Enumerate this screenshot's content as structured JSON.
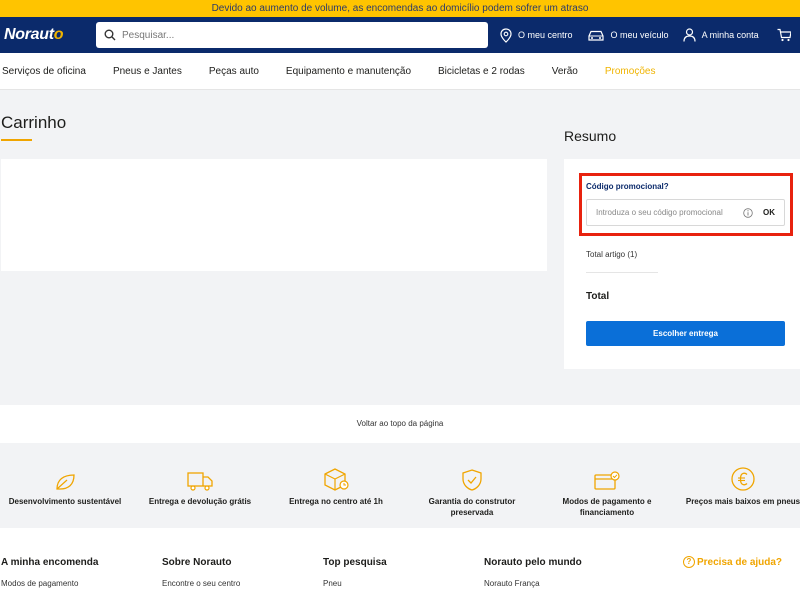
{
  "banner": {
    "text": "Devido ao aumento de volume, as encomendas ao domicílio podem sofrer um atraso"
  },
  "header": {
    "logo_main": "Norauto",
    "search_placeholder": "Pesquisar...",
    "links": {
      "centre": "O meu centro",
      "vehicle": "O meu veículo",
      "account": "A minha conta"
    }
  },
  "nav": {
    "items": [
      "Serviços de oficina",
      "Pneus e Jantes",
      "Peças auto",
      "Equipamento e manutenção",
      "Bicicletas e 2 rodas",
      "Verão",
      "Promoções"
    ]
  },
  "cart": {
    "title": "Carrinho"
  },
  "summary": {
    "title": "Resumo",
    "promo_label": "Código promocional?",
    "promo_placeholder": "Introduza o seu código promocional",
    "promo_value": "",
    "ok_label": "OK",
    "total_items": "Total artigo (1)",
    "total_label": "Total",
    "choose_button": "Escolher entrega"
  },
  "back_to_top": "Voltar ao topo da página",
  "features": [
    {
      "icon": "leaf-icon",
      "label": "Desenvolvimento sustentável"
    },
    {
      "icon": "truck-icon",
      "label": "Entrega e devolução grátis"
    },
    {
      "icon": "parcel-icon",
      "label": "Entrega no centro até 1h"
    },
    {
      "icon": "shield-check-icon",
      "label": "Garantia do construtor preservada"
    },
    {
      "icon": "card-icon",
      "label": "Modos de pagamento e financiamento"
    },
    {
      "icon": "euro-icon",
      "label": "Preços mais baixos em pneus"
    }
  ],
  "footer": {
    "columns": [
      {
        "heading": "A minha encomenda",
        "link": "Modos de pagamento"
      },
      {
        "heading": "Sobre Norauto",
        "link": "Encontre o seu centro"
      },
      {
        "heading": "Top pesquisa",
        "link": "Pneu"
      },
      {
        "heading": "Norauto pelo mundo",
        "link": "Norauto França"
      }
    ],
    "help": "Precisa de ajuda?"
  },
  "colors": {
    "banner": "#ffc400",
    "header": "#0b2a6b",
    "accent": "#f0a500",
    "primary_button": "#0a6fd8",
    "highlight": "#e8220e"
  }
}
